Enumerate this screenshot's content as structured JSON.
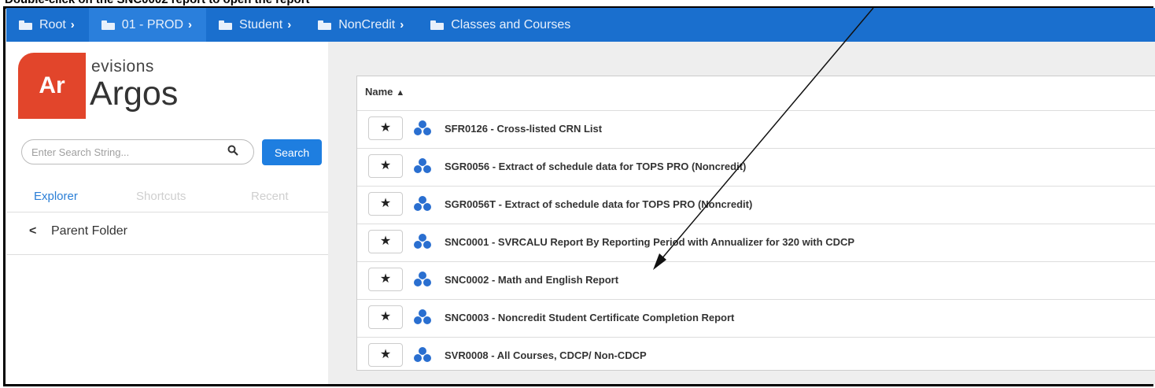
{
  "instruction": "Double-click on the SNC0002 report to open the report",
  "breadcrumbs": [
    {
      "label": "Root",
      "active": false
    },
    {
      "label": "01 - PROD",
      "active": true
    },
    {
      "label": "Student",
      "active": false
    },
    {
      "label": "NonCredit",
      "active": false
    },
    {
      "label": "Classes and Courses",
      "active": false
    }
  ],
  "brand": {
    "logo_text": "Ar",
    "company": "evisions",
    "product": "Argos"
  },
  "search": {
    "placeholder": "Enter Search String...",
    "button_label": "Search"
  },
  "tabs": [
    "Explorer",
    "Shortcuts",
    "Recent"
  ],
  "parent_folder": {
    "arrow": "<",
    "label": "Parent Folder"
  },
  "table": {
    "column_header": "Name",
    "sort_indicator": "▲",
    "star_glyph": "★",
    "rows": [
      "SFR0126 - Cross-listed CRN List",
      "SGR0056 - Extract of schedule data for TOPS PRO (Noncredit)",
      "SGR0056T - Extract of schedule data for TOPS PRO (Noncredit)",
      "SNC0001 - SVRCALU Report By Reporting Period with Annualizer for 320 with CDCP",
      "SNC0002 - Math and English Report",
      "SNC0003 - Noncredit Student Certificate Completion Report",
      "SVR0008 - All Courses, CDCP/ Non-CDCP"
    ]
  },
  "colors": {
    "crumb_bar": "#1a6fce",
    "logo": "#e2452b",
    "accent": "#1e7ee0",
    "report_icon": "#2a6fd0"
  }
}
